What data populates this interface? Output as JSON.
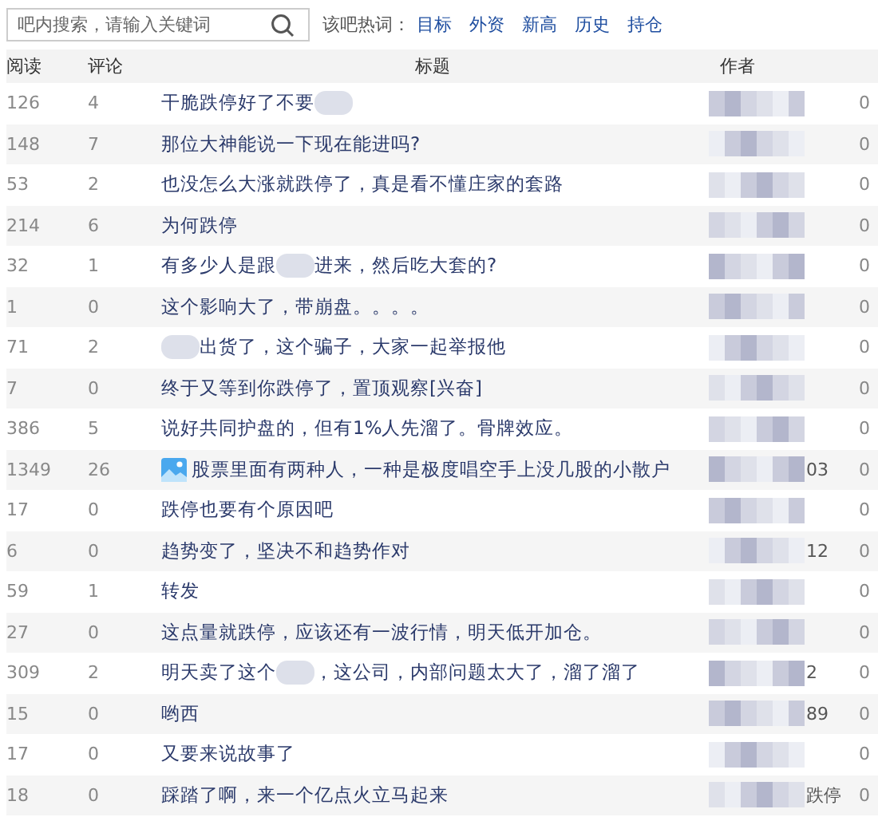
{
  "search": {
    "placeholder": "吧内搜索，请输入关键词"
  },
  "hot_words": {
    "label": "该吧热词：",
    "words": [
      "目标",
      "外资",
      "新高",
      "历史",
      "持仓"
    ]
  },
  "table": {
    "columns": [
      "阅读",
      "评论",
      "标题",
      "作者"
    ],
    "rows": [
      {
        "reads": "126",
        "comments": "4",
        "title": [
          {
            "kind": "text",
            "text": "干脆跌停好了不要"
          },
          {
            "kind": "blur"
          }
        ],
        "author": "",
        "date": "0"
      },
      {
        "reads": "148",
        "comments": "7",
        "title": [
          {
            "kind": "text",
            "text": "那位大神能说一下现在能进吗?"
          }
        ],
        "author": "",
        "date": "0"
      },
      {
        "reads": "53",
        "comments": "2",
        "title": [
          {
            "kind": "text",
            "text": "也没怎么大涨就跌停了，真是看不懂庄家的套路"
          }
        ],
        "author": "",
        "date": "0"
      },
      {
        "reads": "214",
        "comments": "6",
        "title": [
          {
            "kind": "text",
            "text": "为何跌停"
          }
        ],
        "author": "",
        "date": "0"
      },
      {
        "reads": "32",
        "comments": "1",
        "title": [
          {
            "kind": "text",
            "text": "有多少人是跟"
          },
          {
            "kind": "blur"
          },
          {
            "kind": "text",
            "text": "进来，然后吃大套的?"
          }
        ],
        "author": "",
        "date": "0"
      },
      {
        "reads": "1",
        "comments": "0",
        "title": [
          {
            "kind": "text",
            "text": "这个影响大了，带崩盘。。。。"
          }
        ],
        "author": "",
        "date": "0"
      },
      {
        "reads": "71",
        "comments": "2",
        "title": [
          {
            "kind": "blur"
          },
          {
            "kind": "text",
            "text": "出货了，这个骗子，大家一起举报他"
          }
        ],
        "author": "",
        "date": "0"
      },
      {
        "reads": "7",
        "comments": "0",
        "title": [
          {
            "kind": "text",
            "text": "终于又等到你跌停了，置顶观察[兴奋]"
          }
        ],
        "author": "",
        "date": "0"
      },
      {
        "reads": "386",
        "comments": "5",
        "title": [
          {
            "kind": "text",
            "text": "说好共同护盘的，但有1%人先溜了。骨牌效应。"
          }
        ],
        "author": "",
        "date": "0"
      },
      {
        "reads": "1349",
        "comments": "26",
        "has_image": true,
        "title": [
          {
            "kind": "text",
            "text": "股票里面有两种人，一种是极度唱空手上没几股的小散户"
          }
        ],
        "author": "03",
        "date": "0"
      },
      {
        "reads": "17",
        "comments": "0",
        "title": [
          {
            "kind": "text",
            "text": "跌停也要有个原因吧"
          }
        ],
        "author": "",
        "date": "0"
      },
      {
        "reads": "6",
        "comments": "0",
        "title": [
          {
            "kind": "text",
            "text": "趋势变了，坚决不和趋势作对"
          }
        ],
        "author": "12",
        "date": "0"
      },
      {
        "reads": "59",
        "comments": "1",
        "title": [
          {
            "kind": "text",
            "text": "转发"
          }
        ],
        "author": "",
        "date": "0"
      },
      {
        "reads": "27",
        "comments": "0",
        "title": [
          {
            "kind": "text",
            "text": "这点量就跌停，应该还有一波行情，明天低开加仓。"
          }
        ],
        "author": "",
        "date": "0"
      },
      {
        "reads": "309",
        "comments": "2",
        "title": [
          {
            "kind": "text",
            "text": "明天卖了这个"
          },
          {
            "kind": "blur"
          },
          {
            "kind": "text",
            "text": "，这公司，内部问题太大了，溜了溜了"
          }
        ],
        "author": "2",
        "date": "0"
      },
      {
        "reads": "15",
        "comments": "0",
        "title": [
          {
            "kind": "text",
            "text": "哟西"
          }
        ],
        "author": "89",
        "date": "0"
      },
      {
        "reads": "17",
        "comments": "0",
        "title": [
          {
            "kind": "text",
            "text": "又要来说故事了"
          }
        ],
        "author": "",
        "date": "0"
      },
      {
        "reads": "18",
        "comments": "0",
        "title": [
          {
            "kind": "text",
            "text": "踩踏了啊，来一个亿点火立马起来"
          }
        ],
        "author": "跌停",
        "date": "0"
      }
    ]
  }
}
